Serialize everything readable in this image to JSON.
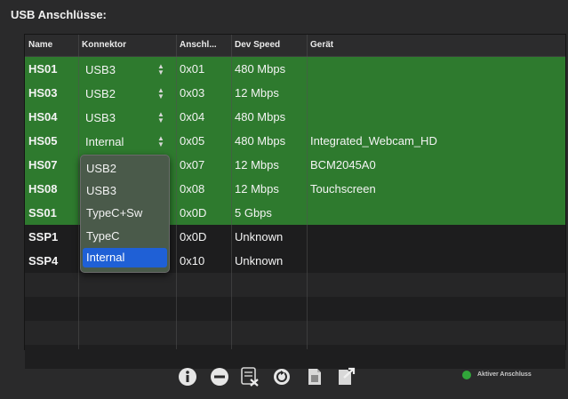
{
  "title": "USB Anschlüsse:",
  "columns": [
    "Name",
    "Konnektor",
    "Anschl...",
    "Dev Speed",
    "Gerät"
  ],
  "rows": [
    {
      "name": "HS01",
      "connector": "USB3",
      "port": "0x01",
      "speed": "480 Mbps",
      "device": "",
      "active": true
    },
    {
      "name": "HS03",
      "connector": "USB2",
      "port": "0x03",
      "speed": "12 Mbps",
      "device": "",
      "active": true
    },
    {
      "name": "HS04",
      "connector": "USB3",
      "port": "0x04",
      "speed": "480 Mbps",
      "device": "",
      "active": true
    },
    {
      "name": "HS05",
      "connector": "Internal",
      "port": "0x05",
      "speed": "480 Mbps",
      "device": "Integrated_Webcam_HD",
      "active": true
    },
    {
      "name": "HS07",
      "connector": "",
      "port": "0x07",
      "speed": "12 Mbps",
      "device": "BCM2045A0",
      "active": true
    },
    {
      "name": "HS08",
      "connector": "",
      "port": "0x08",
      "speed": "12 Mbps",
      "device": "Touchscreen",
      "active": true
    },
    {
      "name": "SS01",
      "connector": "",
      "port": "0x0D",
      "speed": "5 Gbps",
      "device": "",
      "active": true
    },
    {
      "name": "SSP1",
      "connector": "",
      "port": "0x0D",
      "speed": "Unknown",
      "device": "",
      "active": false
    },
    {
      "name": "SSP4",
      "connector": "",
      "port": "0x10",
      "speed": "Unknown",
      "device": "",
      "active": false
    }
  ],
  "dropdown": {
    "options": [
      "USB2",
      "USB3",
      "TypeC+Sw",
      "TypeC",
      "Internal"
    ],
    "selected": "Internal"
  },
  "toolbar": [
    "info-icon",
    "remove-icon",
    "clear-icon",
    "refresh-icon",
    "export-icon",
    "import-icon"
  ],
  "legend": {
    "label": "Aktiver Anschluss",
    "color": "#31a63a"
  },
  "colors": {
    "active_row": "#2e7a2e",
    "selection": "#1f60d6"
  }
}
